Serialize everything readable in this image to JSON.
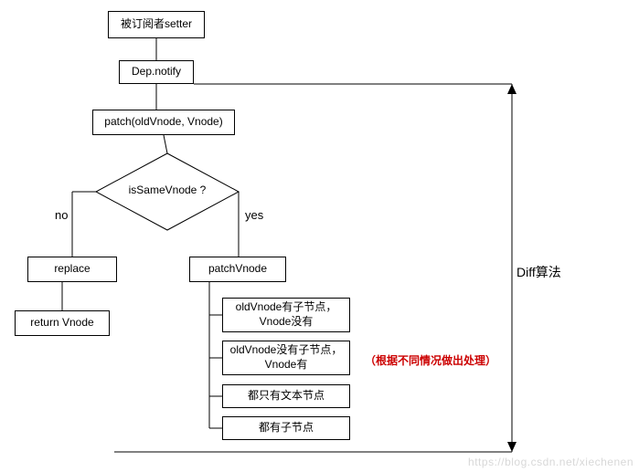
{
  "nodes": {
    "setter": "被订阅者setter",
    "dep_notify": "Dep.notify",
    "patch": "patch(oldVnode, Vnode)",
    "decision": "isSameVnode ?",
    "replace": "replace",
    "return_vnode": "return Vnode",
    "patch_vnode": "patchVnode",
    "case1": "oldVnode有子节点，Vnode没有",
    "case2": "oldVnode没有子节点，Vnode有",
    "case3": "都只有文本节点",
    "case4": "都有子节点"
  },
  "edges": {
    "no": "no",
    "yes": "yes"
  },
  "annotations": {
    "diff": "Diff算法",
    "note": "（根据不同情况做出处理）"
  },
  "watermark": "https://blog.csdn.net/xiechenen"
}
